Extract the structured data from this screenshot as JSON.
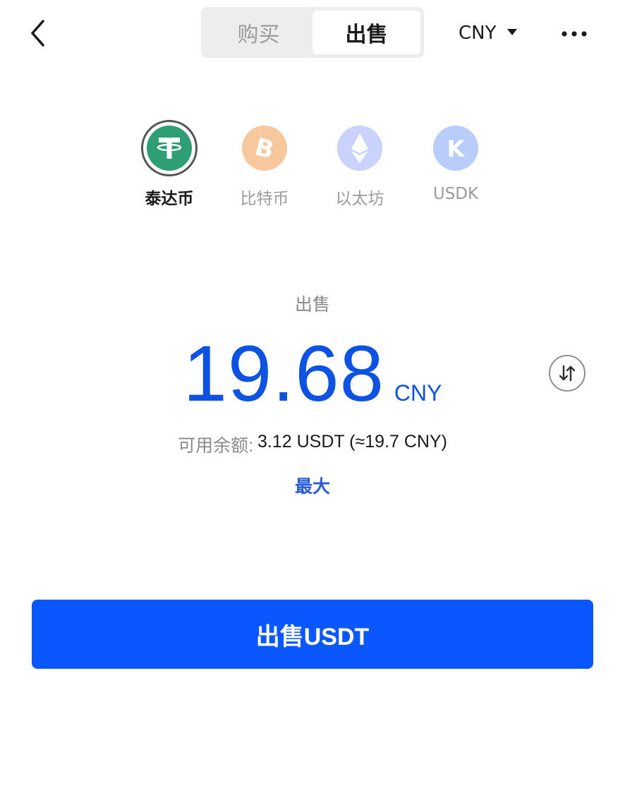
{
  "header": {
    "tabs": [
      {
        "label": "购买",
        "active": false
      },
      {
        "label": "出售",
        "active": true
      }
    ],
    "currency": "CNY"
  },
  "coins": [
    {
      "label": "泰达币",
      "icon": "tether-icon",
      "active": true,
      "color": "#2e9e74"
    },
    {
      "label": "比特币",
      "icon": "bitcoin-icon",
      "active": false,
      "color": "#f7c79d"
    },
    {
      "label": "以太坊",
      "icon": "ethereum-icon",
      "active": false,
      "color": "#c9d3fb"
    },
    {
      "label": "USDK",
      "icon": "usdk-icon",
      "active": false,
      "color": "#b9cdfb"
    }
  ],
  "trade": {
    "action_label": "出售",
    "amount": "19.68",
    "amount_unit": "CNY",
    "balance_label": "可用余额:",
    "balance_value": "3.12 USDT (≈19.7 CNY)",
    "max_label": "最大"
  },
  "submit": {
    "label": "出售USDT"
  },
  "colors": {
    "accent": "#0a56ff",
    "amount": "#0d52e3",
    "link": "#2a5bd6"
  }
}
